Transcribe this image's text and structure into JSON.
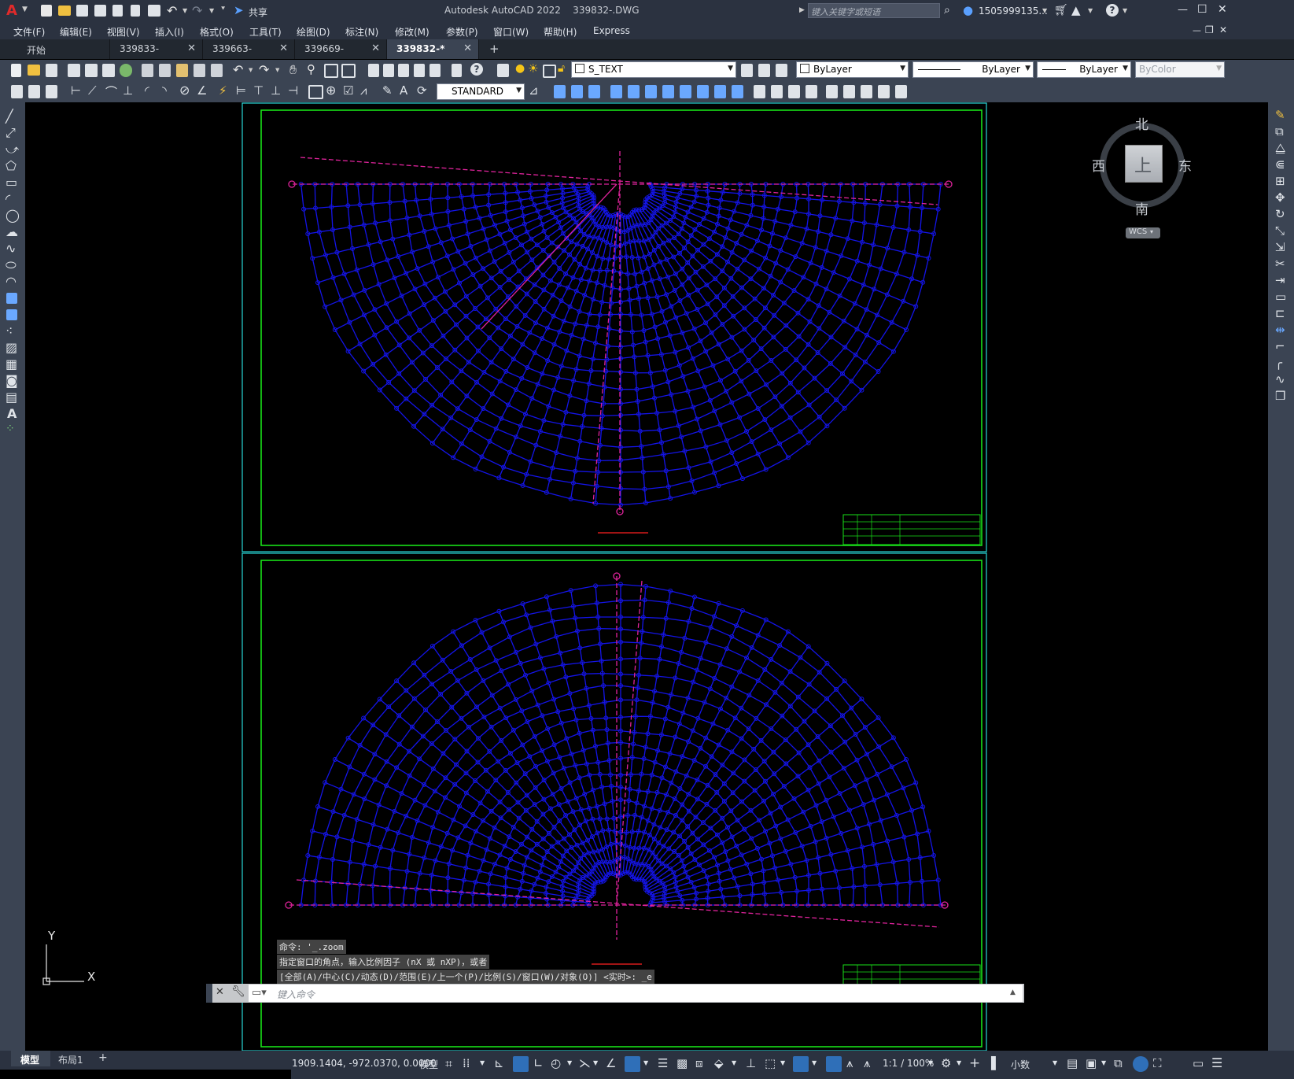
{
  "app": {
    "title": "Autodesk AutoCAD 2022    339832-.DWG",
    "logo": "A",
    "share_label": "共享",
    "search_placeholder": "键入关键字或短语",
    "user": "1505999135...",
    "window_controls": [
      "—",
      "☐",
      "✕"
    ],
    "doc_controls": [
      "—",
      "❐",
      "✕"
    ]
  },
  "menu": [
    "文件(F)",
    "编辑(E)",
    "视图(V)",
    "插入(I)",
    "格式(O)",
    "工具(T)",
    "绘图(D)",
    "标注(N)",
    "修改(M)",
    "参数(P)",
    "窗口(W)",
    "帮助(H)",
    "Express"
  ],
  "tabs": [
    {
      "label": "开始",
      "active": false
    },
    {
      "label": "339833-",
      "active": false
    },
    {
      "label": "339663-",
      "active": false
    },
    {
      "label": "339669-",
      "active": false
    },
    {
      "label": "339832-*",
      "active": true
    }
  ],
  "tab_add": "+",
  "properties": {
    "layer": "S_TEXT",
    "color": "ByLayer",
    "linetype": "ByLayer",
    "lineweight": "ByLayer",
    "plotstyle": "ByColor",
    "textstyle": "STANDARD"
  },
  "viewcube": {
    "north": "北",
    "south": "南",
    "east": "东",
    "west": "西",
    "top": "上",
    "wcs": "WCS"
  },
  "ucs": {
    "x": "X",
    "y": "Y"
  },
  "command_history": [
    "命令: '_.zoom",
    "指定窗口的角点，输入比例因子 (nX 或 nXP)，或者",
    "[全部(A)/中心(C)/动态(D)/范围(E)/上一个(P)/比例(S)/窗口(W)/对象(O)] <实时>: _e"
  ],
  "command_placeholder": "键入命令",
  "layout_tabs": [
    {
      "label": "模型",
      "active": true
    },
    {
      "label": "布局1",
      "active": false
    }
  ],
  "layout_add": "+",
  "status": {
    "coords": "1909.1404, -972.0370, 0.0000",
    "space": "模型",
    "scale": "1:1 / 100%",
    "units": "小数"
  },
  "colors": {
    "mesh": "#1414e8",
    "axis": "#e0239c",
    "frame": "#18e018",
    "sheet": "#29d6d6",
    "accent": "#4ea1ff"
  }
}
